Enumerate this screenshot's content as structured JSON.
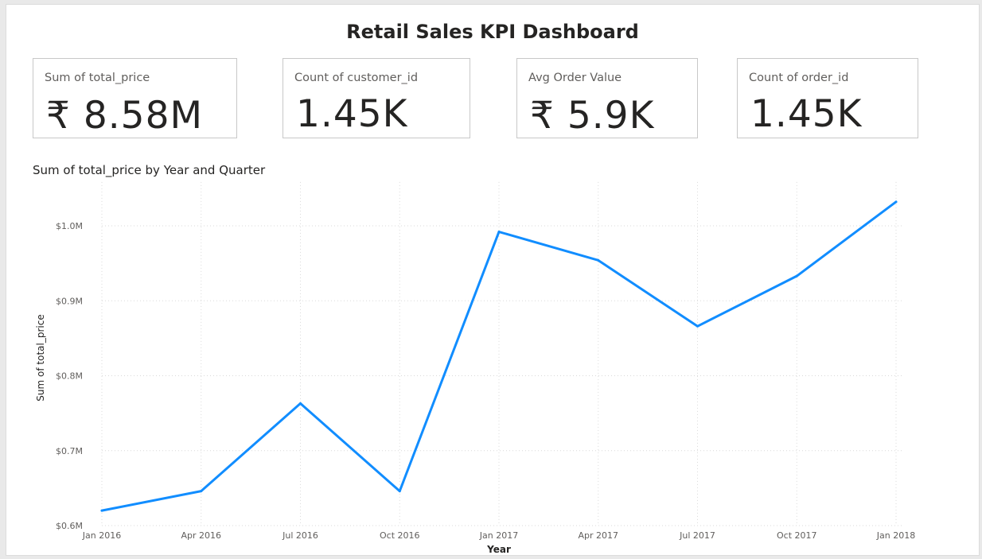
{
  "dashboard": {
    "title": "Retail Sales KPI Dashboard"
  },
  "kpis": [
    {
      "label": "Sum of total_price",
      "value": "₹ 8.58M"
    },
    {
      "label": "Count of customer_id",
      "value": "1.45K"
    },
    {
      "label": "Avg Order Value",
      "value": "₹ 5.9K"
    },
    {
      "label": "Count of order_id",
      "value": "1.45K"
    }
  ],
  "colors": {
    "line": "#118dff",
    "grid": "#d9d9d9",
    "card_border": "#c8c8c8"
  },
  "chart_data": {
    "type": "line",
    "title": "Sum of total_price by Year and Quarter",
    "xlabel": "Year",
    "ylabel": "Sum of total_price",
    "x": [
      "Jan 2016",
      "Apr 2016",
      "Jul 2016",
      "Oct 2016",
      "Jan 2017",
      "Apr 2017",
      "Jul 2017",
      "Oct 2017",
      "Jan 2018"
    ],
    "series": [
      {
        "values": [
          0.62,
          0.646,
          0.763,
          0.646,
          0.992,
          0.954,
          0.866,
          0.933,
          1.032
        ]
      }
    ],
    "y_unit": "M",
    "ylim": [
      0.6,
      1.05
    ],
    "yticks": [
      0.6,
      0.7,
      0.8,
      0.9,
      1.0
    ],
    "ytick_labels": [
      "$0.6M",
      "$0.7M",
      "$0.8M",
      "$0.9M",
      "$1.0M"
    ],
    "grid": true
  }
}
